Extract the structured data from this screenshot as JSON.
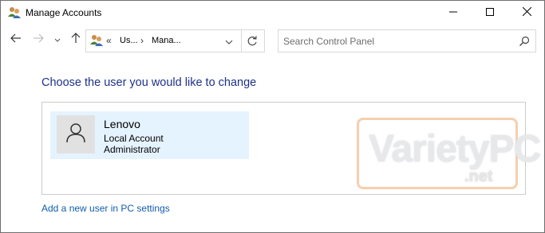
{
  "window": {
    "title": "Manage Accounts",
    "icons": {
      "app": "users-icon",
      "minimize": "minimize-icon",
      "maximize": "maximize-icon",
      "close": "close-icon"
    }
  },
  "navigation": {
    "back_icon": "arrow-left-icon",
    "forward_icon": "arrow-right-icon",
    "recent_icon": "chevron-down-icon",
    "up_icon": "arrow-up-icon"
  },
  "address_bar": {
    "overflow_glyph": "«",
    "segments": [
      "Us...",
      "Mana..."
    ],
    "separator": "›",
    "dropdown_icon": "chevron-down-icon",
    "refresh_icon": "refresh-icon"
  },
  "search": {
    "placeholder": "Search Control Panel",
    "value": "",
    "icon": "search-icon"
  },
  "main": {
    "heading": "Choose the user you would like to change",
    "users": [
      {
        "name": "Lenovo",
        "account_type": "Local Account",
        "role": "Administrator",
        "avatar_icon": "user-icon"
      }
    ],
    "add_user_link": "Add a new user in PC settings"
  },
  "watermark": {
    "text_main": "VarietyPC",
    "text_sub": ".net"
  },
  "colors": {
    "heading": "#1e3287",
    "link": "#0f5cae",
    "tile_selected": "#e5f3ff",
    "avatar_bg": "#e1e1e1",
    "watermark_border": "#f6cfae"
  }
}
